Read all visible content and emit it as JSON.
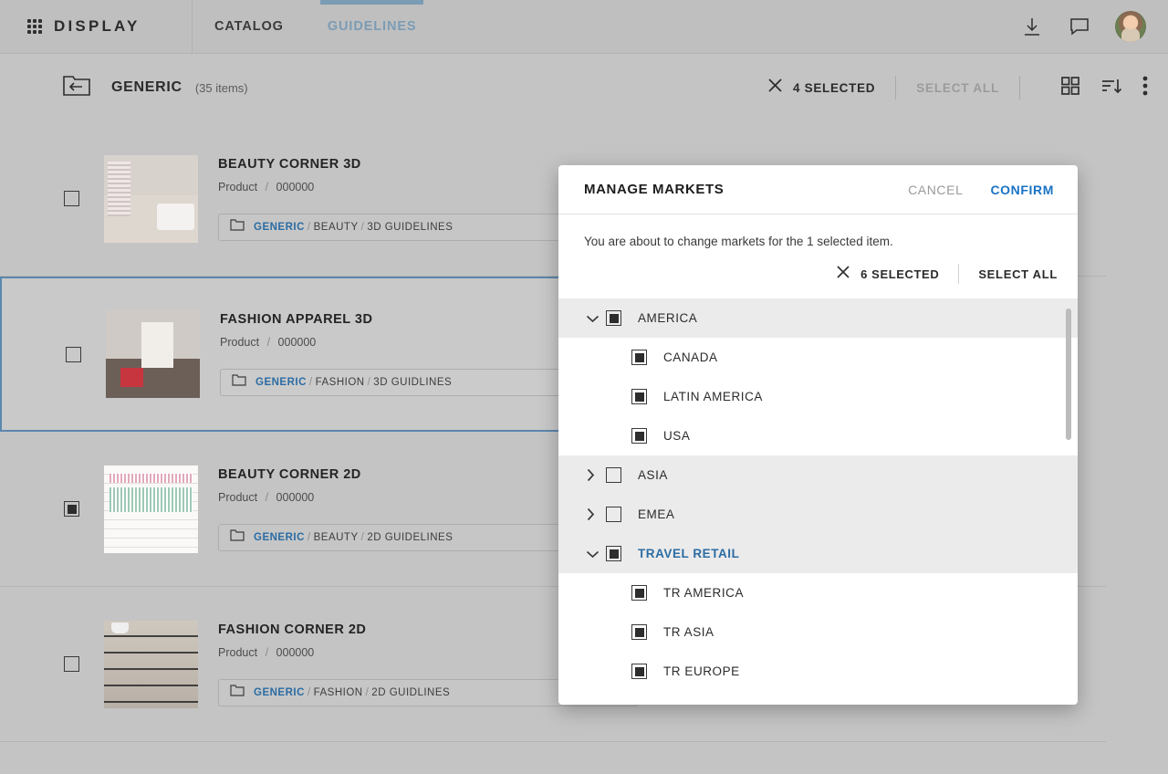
{
  "header": {
    "brand": "DISPLAY",
    "tabs": [
      {
        "label": "CATALOG",
        "active": false
      },
      {
        "label": "GUIDELINES",
        "active": true
      }
    ],
    "icons": [
      "download-icon",
      "comment-icon",
      "avatar"
    ]
  },
  "toolbar": {
    "back_icon": "folder-back-icon",
    "title": "GENERIC",
    "items_count": "(35 items)",
    "close_selection_icon": "close-icon",
    "selected_label": "4 SELECTED",
    "select_all_label": "SELECT ALL",
    "grid_view_icon": "grid-view-icon",
    "sort_icon": "sort-descending-icon",
    "more_icon": "more-vertical-icon"
  },
  "items": [
    {
      "title": "BEAUTY CORNER 3D",
      "type": "Product",
      "code": "000000",
      "crumb_root": "GENERIC",
      "crumb_rest": [
        "BEAUTY",
        "3D GUIDELINES"
      ],
      "checked": false,
      "selected": false,
      "thumb": "beauty-corner-3d-thumbnail"
    },
    {
      "title": "FASHION APPAREL 3D",
      "type": "Product",
      "code": "000000",
      "crumb_root": "GENERIC",
      "crumb_rest": [
        "FASHION",
        "3D GUIDLINES"
      ],
      "checked": false,
      "selected": true,
      "thumb": "fashion-apparel-3d-thumbnail"
    },
    {
      "title": "BEAUTY CORNER 2D",
      "type": "Product",
      "code": "000000",
      "crumb_root": "GENERIC",
      "crumb_rest": [
        "BEAUTY",
        "2D GUIDELINES"
      ],
      "checked": true,
      "selected": false,
      "thumb": "beauty-corner-2d-thumbnail"
    },
    {
      "title": "FASHION CORNER 2D",
      "type": "Product",
      "code": "000000",
      "crumb_root": "GENERIC",
      "crumb_rest": [
        "FASHION",
        "2D GUIDLINES"
      ],
      "checked": false,
      "selected": false,
      "thumb": "fashion-corner-2d-thumbnail"
    }
  ],
  "modal": {
    "title": "MANAGE MARKETS",
    "cancel_label": "CANCEL",
    "confirm_label": "CONFIRM",
    "description": "You are about to change markets for the 1 selected item.",
    "close_selection_icon": "close-icon",
    "selected_label": "6 SELECTED",
    "select_all_label": "SELECT ALL",
    "tree": [
      {
        "label": "AMERICA",
        "level": "group",
        "expanded": true,
        "checked": true,
        "highlight": false
      },
      {
        "label": "CANADA",
        "level": "child",
        "checked": true
      },
      {
        "label": "LATIN AMERICA",
        "level": "child",
        "checked": true
      },
      {
        "label": "USA",
        "level": "child",
        "checked": true
      },
      {
        "label": "ASIA",
        "level": "group",
        "expanded": false,
        "checked": false,
        "highlight": false
      },
      {
        "label": "EMEA",
        "level": "group",
        "expanded": false,
        "checked": false,
        "highlight": false
      },
      {
        "label": "TRAVEL RETAIL",
        "level": "group",
        "expanded": true,
        "checked": true,
        "highlight": true
      },
      {
        "label": "TR AMERICA",
        "level": "child",
        "checked": true
      },
      {
        "label": "TR ASIA",
        "level": "child",
        "checked": true
      },
      {
        "label": "TR EUROPE",
        "level": "child",
        "checked": true
      }
    ]
  },
  "colors": {
    "accent_blue": "#1a73c4",
    "tab_active": "#7b9cb5",
    "crumb_link": "#2b6ca3",
    "page_bg": "#c4c4c4",
    "modal_bg": "#ffffff",
    "group_row_bg": "#ebebeb"
  }
}
